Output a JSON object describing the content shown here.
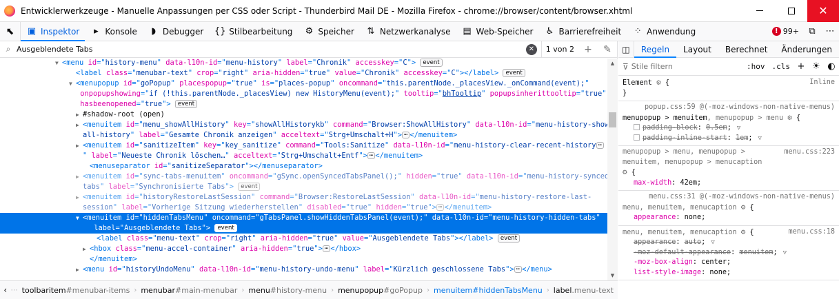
{
  "window": {
    "title": "Entwicklerwerkzeuge - Manuelle Anpassungen per CSS oder Script - Thunderbird Mail DE - Mozilla Firefox - chrome://browser/content/browser.xhtml"
  },
  "toolbar": {
    "tabs": [
      {
        "label": "Inspektor",
        "icon": "inspector-icon"
      },
      {
        "label": "Konsole",
        "icon": "console-icon"
      },
      {
        "label": "Debugger",
        "icon": "debugger-icon"
      },
      {
        "label": "Stilbearbeitung",
        "icon": "braces-icon"
      },
      {
        "label": "Speicher",
        "icon": "memory-icon"
      },
      {
        "label": "Netzwerkanalyse",
        "icon": "network-icon"
      },
      {
        "label": "Web-Speicher",
        "icon": "storage-icon"
      },
      {
        "label": "Barrierefreiheit",
        "icon": "accessibility-icon"
      },
      {
        "label": "Anwendung",
        "icon": "grid-icon"
      }
    ],
    "error_count": "99+"
  },
  "search": {
    "value": "Ausgeblendete Tabs",
    "result_count": "1 von 2"
  },
  "markup": {
    "rows": [
      [
        "<",
        "menu",
        " ",
        "id",
        "=\"",
        "history-menu",
        "\" ",
        "data-l10n-id",
        "=\"",
        "menu-history",
        "\" ",
        "label",
        "=\"",
        "Chronik",
        "\" ",
        "accesskey",
        "=\"",
        "C",
        "\">"
      ],
      [
        "<",
        "label",
        " ",
        "class",
        "=\"",
        "menubar-text",
        "\" ",
        "crop",
        "=\"",
        "right",
        "\" ",
        "aria-hidden",
        "=\"",
        "true",
        "\" ",
        "value",
        "=\"",
        "Chronik",
        "\" ",
        "accesskey",
        "=\"",
        "C",
        "\"></",
        "label",
        ">"
      ],
      [
        "<",
        "menupopup",
        " ",
        "id",
        "=\"",
        "goPopup",
        "\" ",
        "placespopup",
        "=\"",
        "true",
        "\" ",
        "is",
        "=\"",
        "places-popup",
        "\" ",
        "oncommand",
        "=\"",
        "this.parentNode._placesView._onCommand(event);",
        "\""
      ],
      [
        " ",
        "onpopupshowing",
        "=\"",
        "if (!this.parentNode._placesView) new HistoryMenu(event);",
        "\" ",
        "tooltip",
        "=\"",
        "bhTooltip",
        "\" ",
        "popupsinherittooltip",
        "=\"",
        "true",
        "\""
      ],
      [
        " ",
        "hasbeenopened",
        "=\"",
        "true",
        "\">"
      ],
      [
        "#shadow-root (open)"
      ],
      [
        "<",
        "menuitem",
        " ",
        "id",
        "=\"",
        "menu_showAllHistory",
        "\" ",
        "key",
        "=\"",
        "showAllHistorykb",
        "\" ",
        "command",
        "=\"",
        "Browser:ShowAllHistory",
        "\" ",
        "data-l10n-id",
        "=\"",
        "menu-history-show-"
      ],
      [
        "all-history",
        "\" ",
        "label",
        "=\"",
        "Gesamte Chronik anzeigen",
        "\" ",
        "acceltext",
        "=\"",
        "Strg+Umschalt+H",
        "\">",
        "</",
        "menuitem",
        ">"
      ],
      [
        "<",
        "menuitem",
        " ",
        "id",
        "=\"",
        "sanitizeItem",
        "\" ",
        "key",
        "=\"",
        "key_sanitize",
        "\" ",
        "command",
        "=\"",
        "Tools:Sanitize",
        "\" ",
        "data-l10n-id",
        "=\"",
        "menu-history-clear-recent-history"
      ],
      [
        "\" ",
        "label",
        "=\"",
        "Neueste Chronik löschen…",
        "\" ",
        "acceltext",
        "=\"",
        "Strg+Umschalt+Entf",
        "\">",
        "</",
        "menuitem",
        ">"
      ],
      [
        "<",
        "menuseparator",
        " ",
        "id",
        "=\"",
        "sanitizeSeparator",
        "\"></",
        "menuseparator",
        ">"
      ],
      [
        "<",
        "menuitem",
        " ",
        "id",
        "=\"",
        "sync-tabs-menuitem",
        "\" ",
        "oncommand",
        "=\"",
        "gSync.openSyncedTabsPanel();",
        "\" ",
        "hidden",
        "=\"",
        "true",
        "\" ",
        "data-l10n-id",
        "=\"",
        "menu-history-synced-"
      ],
      [
        "tabs",
        "\" ",
        "label",
        "=\"",
        "Synchronisierte Tabs",
        "\">"
      ],
      [
        "<",
        "menuitem",
        " ",
        "id",
        "=\"",
        "historyRestoreLastSession",
        "\" ",
        "command",
        "=\"",
        "Browser:RestoreLastSession",
        "\" ",
        "data-l10n-id",
        "=\"",
        "menu-history-restore-last-"
      ],
      [
        "session",
        "\" ",
        "label",
        "=\"",
        "Vorherige Sitzung wiederherstellen",
        "\" ",
        "disabled",
        "=\"",
        "true",
        "\" ",
        "hidden",
        "=\"",
        "true",
        "\">",
        "</",
        "menuitem",
        ">"
      ],
      [
        "<",
        "menuitem",
        " ",
        "id",
        "=\"",
        "hiddenTabsMenu",
        "\" ",
        "oncommand",
        "=\"",
        "gTabsPanel.showHiddenTabsPanel(event);",
        "\" ",
        "data-l10n-id",
        "=\"",
        "menu-history-hidden-tabs",
        "\""
      ],
      [
        " ",
        "label",
        "=\"",
        "Ausgeblendete Tabs",
        "\">"
      ],
      [
        "<",
        "label",
        " ",
        "class",
        "=\"",
        "menu-text",
        "\" ",
        "crop",
        "=\"",
        "right",
        "\" ",
        "aria-hidden",
        "=\"",
        "true",
        "\" ",
        "value",
        "=\"",
        "Ausgeblendete Tabs",
        "\"></",
        "label",
        ">"
      ],
      [
        "<",
        "hbox",
        " ",
        "class",
        "=\"",
        "menu-accel-container",
        "\" ",
        "aria-hidden",
        "=\"",
        "true",
        "\">",
        "</",
        "hbox",
        ">"
      ],
      [
        "</",
        "menuitem",
        ">"
      ],
      [
        "<",
        "menu",
        " ",
        "id",
        "=\"",
        "historyUndoMenu",
        "\" ",
        "data-l10n-id",
        "=\"",
        "menu-history-undo-menu",
        "\" ",
        "label",
        "=\"",
        "Kürzlich geschlossene Tabs",
        "\">",
        "</",
        "menu",
        ">"
      ]
    ],
    "event_badge": "event",
    "ellipsis": "⋯"
  },
  "breadcrumbs": [
    {
      "tag": "toolbaritem",
      "id": "#menubar-items"
    },
    {
      "tag": "menubar",
      "id": "#main-menubar"
    },
    {
      "tag": "menu",
      "id": "#history-menu"
    },
    {
      "tag": "menupopup",
      "id": "#goPopup"
    },
    {
      "tag": "menuitem",
      "id": "#hiddenTabsMenu"
    },
    {
      "tag": "label",
      "id": ".menu-text"
    }
  ],
  "rules_panel": {
    "tabs": [
      "Regeln",
      "Layout",
      "Berechnet",
      "Änderungen"
    ],
    "filter_placeholder": "Stile filtern",
    "hov": ":hov",
    "cls": ".cls",
    "element_rule": {
      "selector": "Element",
      "brace_open": "{",
      "brace_close": "}",
      "source": "Inline"
    },
    "rules": [
      {
        "source": "popup.css:59 @(-moz-windows-non-native-menus)",
        "selector_main": "menupopup > menuitem",
        "selector_rest": ", menupopup > menu",
        "decls": [
          {
            "name": "padding-block",
            "value": "0.5em",
            "struck": true
          },
          {
            "name": "padding-inline-start",
            "value": "1em",
            "struck": true
          }
        ]
      },
      {
        "source": "menu.css:223",
        "selector_text": "menupopup > menu, menupopup > menuitem, menupopup > menucaption",
        "decls": [
          {
            "name": "max-width",
            "value": "42em",
            "struck": false
          }
        ]
      },
      {
        "source": "menu.css:31 @(-moz-windows-non-native-menus)",
        "selector_text": "menu, menuitem, menucaption",
        "decls": [
          {
            "name": "appearance",
            "value": "none",
            "struck": false
          }
        ]
      },
      {
        "source": "menu.css:18",
        "selector_text": "menu, menuitem, menucaption",
        "decls": [
          {
            "name": "appearance",
            "value": "auto",
            "struck": true
          },
          {
            "name": "-moz-default-appearance",
            "value": "menuitem",
            "struck": true
          },
          {
            "name": "-moz-box-align",
            "value": "center",
            "struck": false
          },
          {
            "name": "list-style-image",
            "value": "none",
            "struck": false
          }
        ]
      }
    ]
  },
  "colors": {
    "accent": "#0a84ff",
    "selection": "#0074e8",
    "close": "#e81123"
  }
}
